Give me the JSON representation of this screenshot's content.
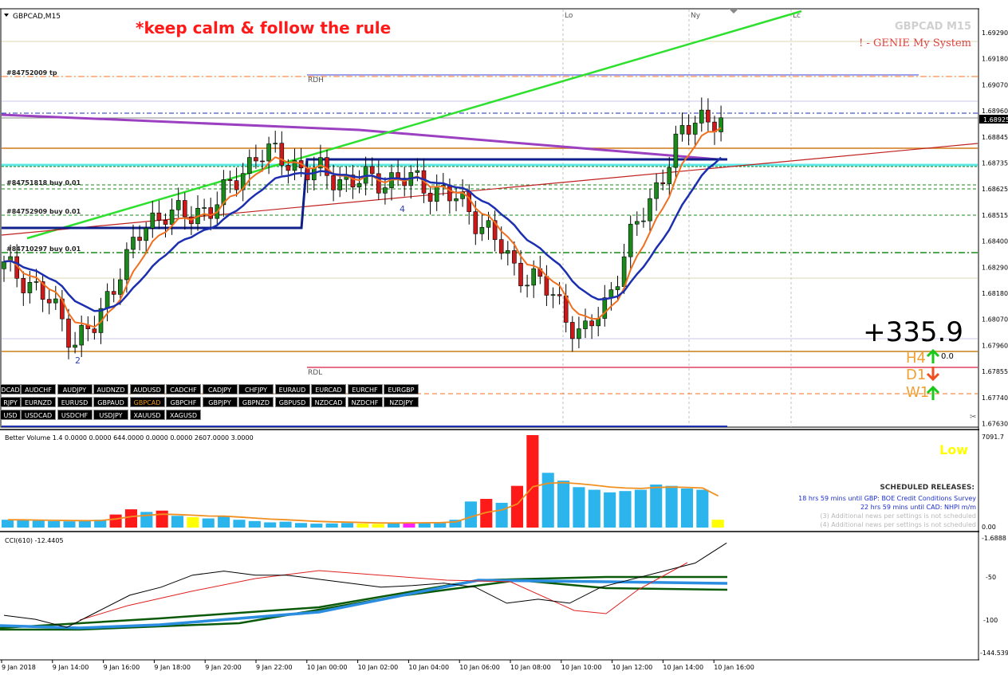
{
  "header": {
    "symbol_title": "GBPCAD,M15",
    "motto": "*keep calm & follow the rule",
    "watermark_symbol": "GBPCAD M15",
    "watermark_system": "! - GENIE My System",
    "session_labels": [
      "Lo",
      "Ny",
      "Lc"
    ]
  },
  "main_chart": {
    "price_axis": [
      "1.69290",
      "1.69180",
      "1.69070",
      "1.68960",
      "1.68845",
      "1.68735",
      "1.68625",
      "1.68515",
      "1.68400",
      "1.68290",
      "1.68180",
      "1.68070",
      "1.67960",
      "1.67855",
      "1.67740",
      "1.67630"
    ],
    "current_price": "1.68925",
    "order_labels": [
      "#84752009 tp",
      "#84751818 buy 0.01",
      "#84752909 buy 0.01",
      "#84710297 buy 0.01"
    ],
    "level_labels": {
      "rdh": "RDH",
      "rdl": "RDL"
    },
    "wave_labels": [
      "2",
      "4"
    ],
    "pips_total": "+335.9",
    "timeframes": [
      {
        "label": "H4",
        "arrow": "up",
        "value": "0.0"
      },
      {
        "label": "D1",
        "arrow": "down",
        "value": ""
      },
      {
        "label": "W1",
        "arrow": "up",
        "value": ""
      }
    ]
  },
  "symbols_row1": [
    "DCAD",
    "AUDCHF",
    "AUDJPY",
    "AUDNZD",
    "AUDUSD",
    "CADCHF",
    "CADJPY",
    "CHFJPY",
    "EURAUD",
    "EURCAD",
    "EURCHF",
    "EURGBP"
  ],
  "symbols_row2": [
    "RJPY",
    "EURNZD",
    "EURUSD",
    "GBPAUD",
    "GBPCAD",
    "GBPCHF",
    "GBPJPY",
    "GBPNZD",
    "GBPUSD",
    "NZDCAD",
    "NZDCHF",
    "NZDJPY"
  ],
  "symbols_row3": [
    "USD",
    "USDCAD",
    "USDCHF",
    "USDJPY",
    "XAUUSD",
    "XAGUSD"
  ],
  "active_symbol": "GBPCAD",
  "volume_panel": {
    "title": "Better Volume 1.4 0.0000 0.0000 644.0000 0.0000 0.0000 2607.0000 3.0000",
    "max_label": "7091.7",
    "min_label": "0.00",
    "status": "Low",
    "news_heading": "SCHEDULED RELEASES:",
    "news": [
      "18 hrs 59 mins until GBP: BOE Credit Conditions Survey",
      "22 hrs 59 mins until CAD: NHPI m/m",
      "(3)  Additional news per settings is not scheduled",
      "(4)  Additional news per settings is not scheduled"
    ]
  },
  "cci_panel": {
    "title": "CCI(610) -12.4405",
    "axis": [
      "-1.6888",
      "-50",
      "-100",
      "-144.539"
    ]
  },
  "time_axis": [
    "9 Jan 2018",
    "9 Jan 14:00",
    "9 Jan 16:00",
    "9 Jan 18:00",
    "9 Jan 20:00",
    "9 Jan 22:00",
    "10 Jan 00:00",
    "10 Jan 02:00",
    "10 Jan 04:00",
    "10 Jan 06:00",
    "10 Jan 08:00",
    "10 Jan 10:00",
    "10 Jan 12:00",
    "10 Jan 14:00",
    "10 Jan 16:00"
  ],
  "chart_data": {
    "type": "line",
    "title": "GBPCAD,M15",
    "x": [
      "9 Jan 2018",
      "9 Jan 14:00",
      "9 Jan 16:00",
      "9 Jan 18:00",
      "9 Jan 20:00",
      "9 Jan 22:00",
      "10 Jan 00:00",
      "10 Jan 02:00",
      "10 Jan 04:00",
      "10 Jan 06:00",
      "10 Jan 08:00",
      "10 Jan 10:00",
      "10 Jan 12:00",
      "10 Jan 14:00",
      "10 Jan 16:00"
    ],
    "closes": [
      1.683,
      1.6825,
      1.6815,
      1.68,
      1.6805,
      1.683,
      1.6845,
      1.6855,
      1.685,
      1.6857,
      1.6865,
      1.688,
      1.6875,
      1.6872,
      1.6868,
      1.6867,
      1.6866,
      1.6868,
      1.6865,
      1.6862,
      1.6855,
      1.6845,
      1.683,
      1.6825,
      1.6815,
      1.68,
      1.6815,
      1.684,
      1.686,
      1.688,
      1.6895,
      1.689
    ],
    "volume": [
      600,
      560,
      520,
      500,
      480,
      510,
      600,
      1000,
      1400,
      1200,
      1300,
      900,
      800,
      700,
      850,
      600,
      500,
      400,
      450,
      350,
      300,
      320,
      350,
      300,
      280,
      320,
      400,
      380,
      420,
      600,
      2000,
      2200,
      1900,
      3200,
      7091.7,
      4200,
      3600,
      3100,
      2900,
      2700,
      2800,
      2900,
      3300,
      3200,
      3000,
      2900,
      600
    ],
    "volume_colors_used": [
      "#2bb5ec",
      "#ff1a1a",
      "#ffff00",
      "#ff22ff"
    ],
    "cci": [
      -95,
      -100,
      -110,
      -90,
      -70,
      -60,
      -45,
      -40,
      -45,
      -45,
      -50,
      -55,
      -60,
      -58,
      -55,
      -60,
      -80,
      -75,
      -80,
      -60,
      -50,
      -40,
      -30,
      -5
    ],
    "ylim": [
      1.6763,
      1.6929
    ],
    "grid": true
  },
  "colors": {
    "bull_candle": "#1a8a1a",
    "bear_candle": "#cc1a1a",
    "ema_fast": "#f07020",
    "ema_slow": "#1c2fb0",
    "trendline": "#2ee02e",
    "purple_ma": "#9b40c0",
    "volume_blue": "#2bb5ec",
    "volume_red": "#ff1a1a",
    "volume_yellow": "#ffff00",
    "volume_magenta": "#ff22ff",
    "motto": "#ff1a1a",
    "status_low": "#ffff00"
  }
}
